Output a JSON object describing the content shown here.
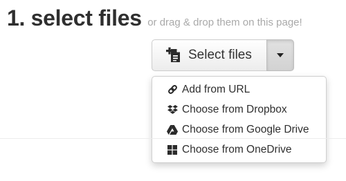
{
  "header": {
    "title": "1. select files",
    "hint": "or drag & drop them on this page!"
  },
  "upload_button": {
    "label": "Select files",
    "icon": "file-add-icon"
  },
  "caret_button": {
    "icon": "caret-down-icon"
  },
  "dropdown": {
    "items": [
      {
        "label": "Add from URL",
        "icon": "link-icon"
      },
      {
        "label": "Choose from Dropbox",
        "icon": "dropbox-icon"
      },
      {
        "label": "Choose from Google Drive",
        "icon": "google-drive-icon"
      },
      {
        "label": "Choose from OneDrive",
        "icon": "windows-icon"
      }
    ]
  }
}
